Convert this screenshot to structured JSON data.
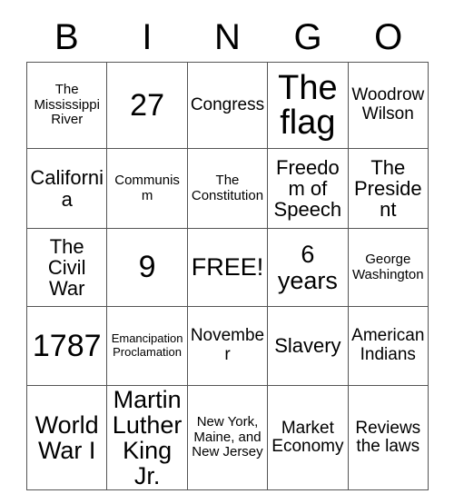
{
  "card": {
    "title": "BINGO",
    "header_letters": [
      "B",
      "I",
      "N",
      "G",
      "O"
    ],
    "free_space_label": "FREE!",
    "border_color": "#555555",
    "text_color": "#000000",
    "background_color": "#ffffff",
    "rows": [
      [
        {
          "text": "The Mississippi River",
          "size": "sz-s"
        },
        {
          "text": "27",
          "size": "sz-xxl"
        },
        {
          "text": "Congress",
          "size": "sz-m"
        },
        {
          "text": "The flag",
          "size": "sz-huge"
        },
        {
          "text": "Woodrow Wilson",
          "size": "sz-m"
        }
      ],
      [
        {
          "text": "California",
          "size": "sz-l"
        },
        {
          "text": "Communism",
          "size": "sz-s"
        },
        {
          "text": "The Constitution",
          "size": "sz-s"
        },
        {
          "text": "Freedom of Speech",
          "size": "sz-l"
        },
        {
          "text": "The President",
          "size": "sz-l"
        }
      ],
      [
        {
          "text": "The Civil War",
          "size": "sz-l"
        },
        {
          "text": "9",
          "size": "sz-xxl"
        },
        {
          "text": "FREE!",
          "size": "sz-xl"
        },
        {
          "text": "6 years",
          "size": "sz-xl"
        },
        {
          "text": "George Washington",
          "size": "sz-s"
        }
      ],
      [
        {
          "text": "1787",
          "size": "sz-xxl"
        },
        {
          "text": "Emancipation Proclamation",
          "size": "sz-xs"
        },
        {
          "text": "November",
          "size": "sz-m"
        },
        {
          "text": "Slavery",
          "size": "sz-l"
        },
        {
          "text": "American Indians",
          "size": "sz-m"
        }
      ],
      [
        {
          "text": "World War I",
          "size": "sz-xl"
        },
        {
          "text": "Martin Luther King Jr.",
          "size": "sz-xl"
        },
        {
          "text": "New York, Maine, and New Jersey",
          "size": "sz-s"
        },
        {
          "text": "Market Economy",
          "size": "sz-m"
        },
        {
          "text": "Reviews the laws",
          "size": "sz-m"
        }
      ]
    ]
  }
}
